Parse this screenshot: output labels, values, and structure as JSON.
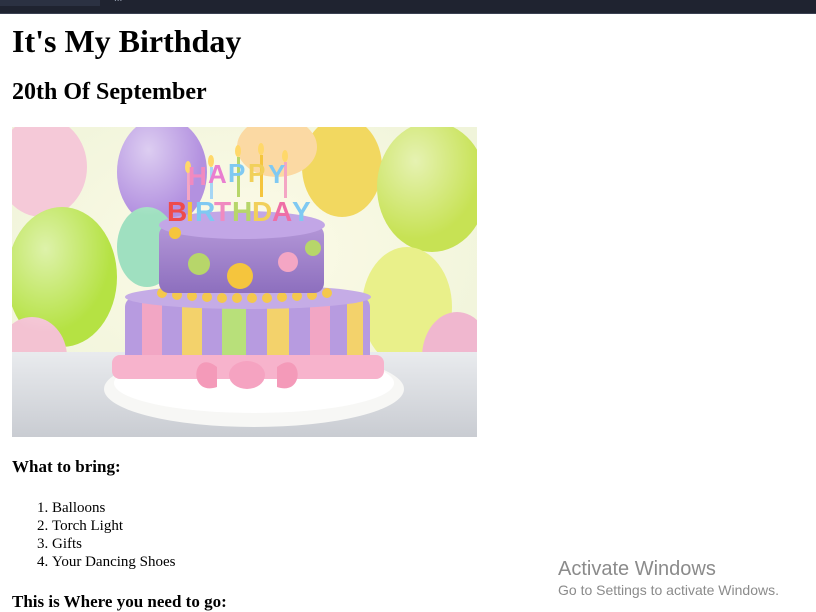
{
  "browser": {
    "address_text": "...",
    "bar_color": "#1f2330"
  },
  "page": {
    "title": "It's My Birthday",
    "date": "20th Of September",
    "image_icon": "birthday-cake-image",
    "bring_heading": "What to bring:",
    "bring_items": [
      "Balloons",
      "Torch Light",
      "Gifts",
      "Your Dancing Shoes"
    ],
    "location_heading": "This is Where you need to go:"
  },
  "watermark": {
    "title": "Activate Windows",
    "subtitle": "Go to Settings to activate Windows."
  }
}
